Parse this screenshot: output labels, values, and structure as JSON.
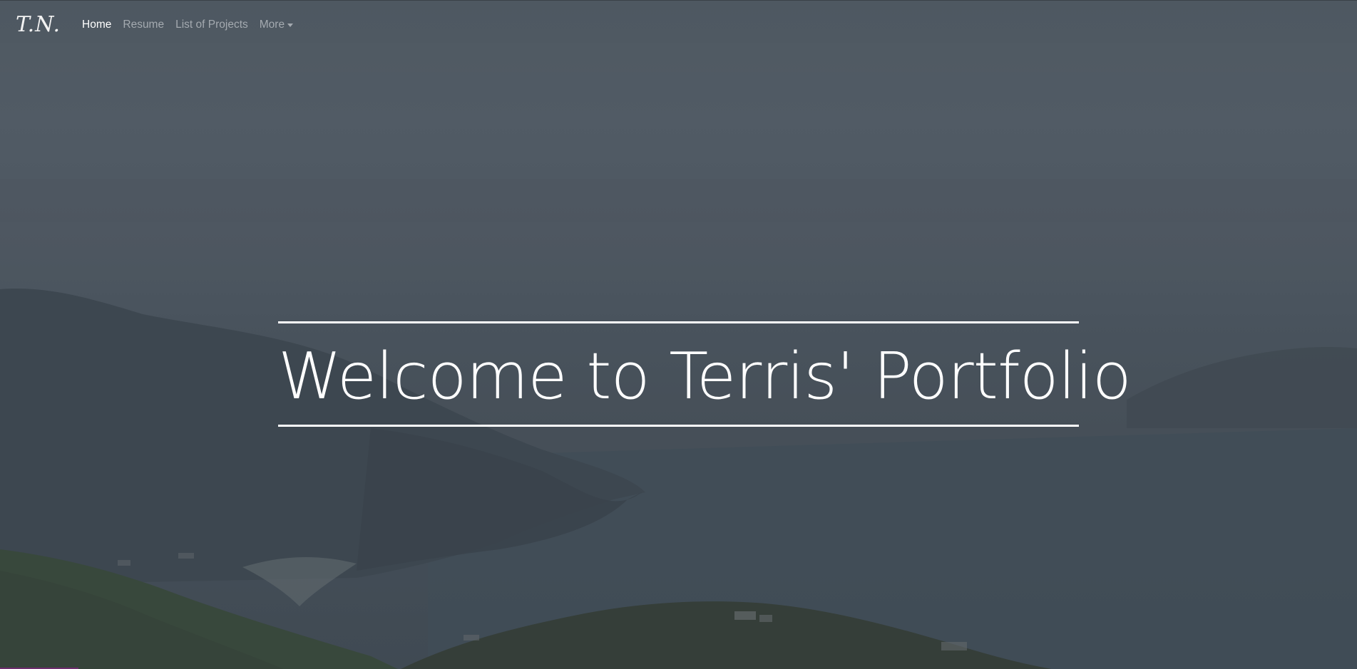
{
  "navbar": {
    "brand": "T.N.",
    "links": [
      {
        "label": "Home",
        "active": true
      },
      {
        "label": "Resume",
        "active": false
      },
      {
        "label": "List of Projects",
        "active": false
      }
    ],
    "dropdown": {
      "label": "More"
    }
  },
  "hero": {
    "title": "Welcome to Terris' Portfolio"
  },
  "colors": {
    "nav_active": "#ffffff",
    "nav_inactive": "#a4aab0",
    "overlay": "#4a545d",
    "hero_text": "#ffffff"
  },
  "icons": [
    "caret-down-icon"
  ]
}
